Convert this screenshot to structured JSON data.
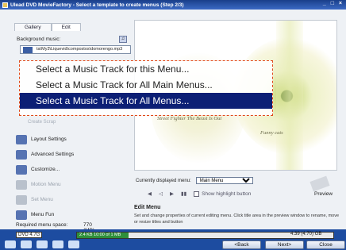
{
  "window": {
    "title": "Ulead DVD MovieFactory - Select a template to create menus (Step 2/3)"
  },
  "tabs": [
    {
      "label": "Gallery"
    },
    {
      "label": "Edit"
    }
  ],
  "background_music": {
    "label": "Background music:",
    "path": "ta\\My3\\Liquevid\\compostos\\domorengo.mp3"
  },
  "popup": {
    "options": [
      "Select a Music Track for this Menu...",
      "Select a Music Track for All Main Menus...",
      "Select a Music Track for All Menus..."
    ],
    "selected_index": 2
  },
  "left_items": [
    {
      "label": "Layout Settings",
      "enabled": true
    },
    {
      "label": "Advanced Settings",
      "enabled": true
    },
    {
      "label": "Customize...",
      "enabled": true
    },
    {
      "label": "Motion Menu",
      "enabled": false
    },
    {
      "label": "Set Menu",
      "enabled": false
    },
    {
      "label": "Menu Fun",
      "enabled": true
    }
  ],
  "left_ghost_text": "Create Scrap",
  "required_space": {
    "label": "Required menu space:",
    "value": "770 (MB)"
  },
  "preview": {
    "line1": "Street Fighter  The Beast Is Out",
    "line2": "Funny cats"
  },
  "menu_selector": {
    "label": "Currently displayed menu:",
    "value": "Main Menu"
  },
  "controls": {
    "prev": "◀",
    "prev_frame": "◁",
    "play": "▶",
    "pause": "▮▮",
    "show_highlight": "Show highlight button"
  },
  "preview_button": "Preview",
  "edit_menu": {
    "heading": "Edit Menu",
    "description": "Set and change properties of current editing menu. Click title area in the preview window to rename, move or resize titles and button"
  },
  "disc": {
    "type": "DVD 4.7G",
    "bar_text": "2.4 KB 10:00 of 1 MB",
    "size": "4.39 (4.70) GB",
    "fill_fraction": 0.2
  },
  "nav": {
    "back": "<Back",
    "next": "Next>",
    "close": "Close"
  },
  "colors": {
    "selection": "#0c1f75",
    "popup_border": "#e04a1a",
    "bottom_bar": "#1d4ca0"
  }
}
